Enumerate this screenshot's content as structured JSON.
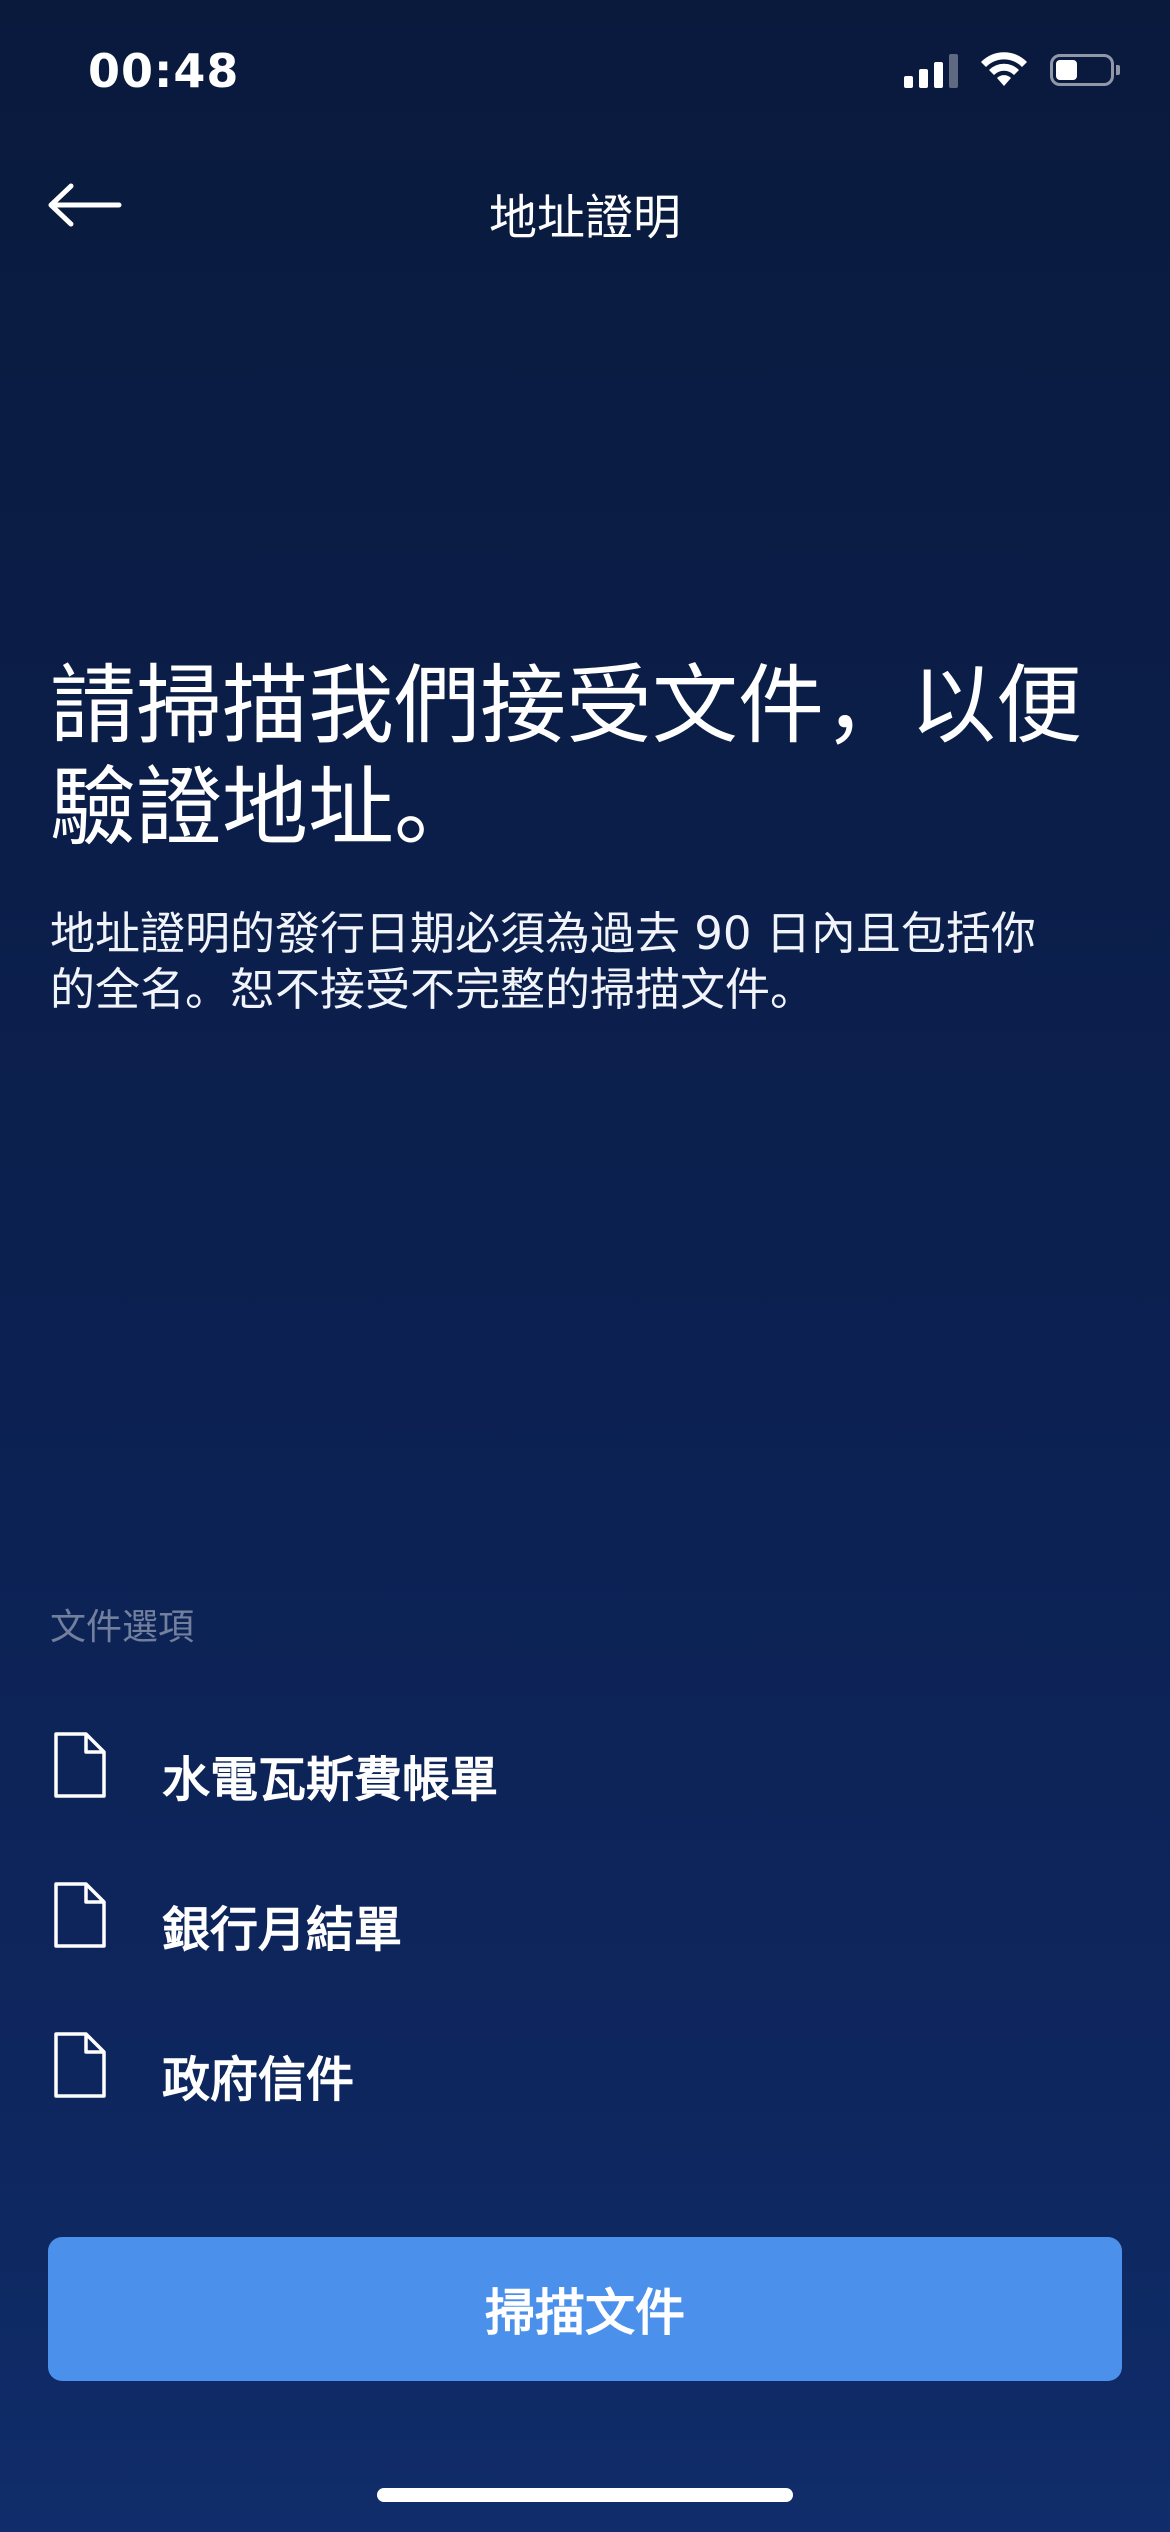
{
  "status_bar": {
    "time": "00:48",
    "battery_level": 0.4
  },
  "nav": {
    "title": "地址證明",
    "back_icon": "arrow-left-icon"
  },
  "main": {
    "headline_line1": "請掃描我們接受文件，以便",
    "headline_line2": "驗證地址。",
    "description_line1": "地址證明的發行日期必須為過去 90 日內且包括你",
    "description_line2": "的全名。恕不接受不完整的掃描文件。"
  },
  "options": {
    "heading": "文件選項",
    "items": [
      {
        "label": "水電瓦斯費帳單",
        "icon": "document-icon"
      },
      {
        "label": "銀行月結單",
        "icon": "document-icon"
      },
      {
        "label": "政府信件",
        "icon": "document-icon"
      }
    ]
  },
  "footer": {
    "scan_button_label": "掃描文件"
  },
  "colors": {
    "background_top": "#0a1a3d",
    "background_bottom": "#0f2a66",
    "accent": "#4b90ea"
  }
}
